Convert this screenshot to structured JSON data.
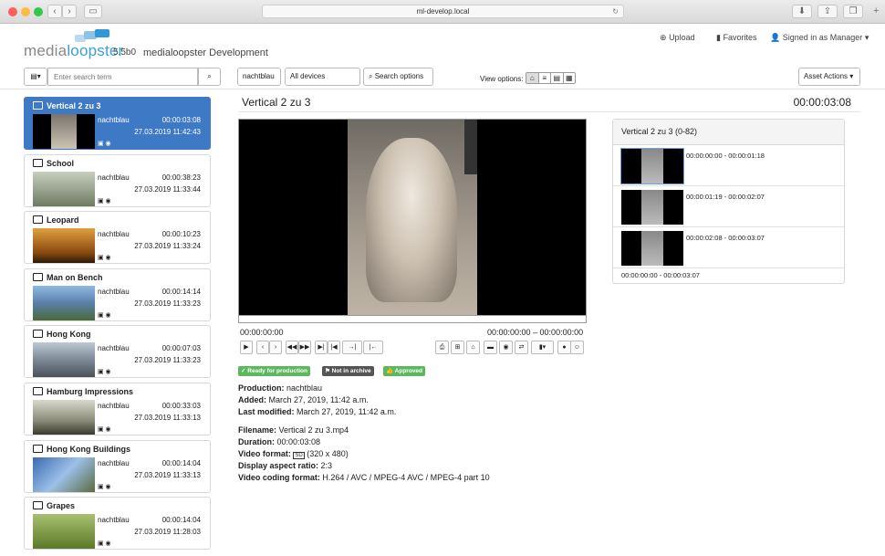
{
  "browser": {
    "url": "ml-develop.local",
    "back": "‹",
    "fwd": "›"
  },
  "app": {
    "logo_a": "media",
    "logo_b": "loopster",
    "version": "5.5b0",
    "name": "medialoopster Development"
  },
  "nav": {
    "upload": "Upload",
    "favorites": "Favorites",
    "signed_in": "Signed in as Manager"
  },
  "search": {
    "placeholder": "Enter search term"
  },
  "filters": {
    "production": "nachtblau",
    "devices": "All devices",
    "options": "Search options"
  },
  "view_options_label": "View options:",
  "asset_actions": "Asset Actions",
  "assets": [
    {
      "title": "Vertical 2 zu 3",
      "production": "nachtblau",
      "duration": "00:00:03:08",
      "date": "27.03.2019 11:42:43"
    },
    {
      "title": "School",
      "production": "nachtblau",
      "duration": "00:00:38:23",
      "date": "27.03.2019 11:33:44"
    },
    {
      "title": "Leopard",
      "production": "nachtblau",
      "duration": "00:00:10:23",
      "date": "27.03.2019 11:33:24"
    },
    {
      "title": "Man on Bench",
      "production": "nachtblau",
      "duration": "00:00:14:14",
      "date": "27.03.2019 11:33:23"
    },
    {
      "title": "Hong Kong",
      "production": "nachtblau",
      "duration": "00:00:07:03",
      "date": "27.03.2019 11:33:23"
    },
    {
      "title": "Hamburg Impressions",
      "production": "nachtblau",
      "duration": "00:00:33:03",
      "date": "27.03.2019 11:33:13"
    },
    {
      "title": "Hong Kong Buildings",
      "production": "nachtblau",
      "duration": "00:00:14:04",
      "date": "27.03.2019 11:33:13"
    },
    {
      "title": "Grapes",
      "production": "nachtblau",
      "duration": "00:00:14:04",
      "date": "27.03.2019 11:28:03"
    }
  ],
  "detail": {
    "title": "Vertical 2 zu 3",
    "duration": "00:00:03:08",
    "time_current": "00:00:00:00",
    "time_range": "00:00:00:00 – 00:00:00:00",
    "tags": {
      "ready": "Ready for production",
      "archive": "Not in archive",
      "approved": "Approved"
    },
    "production_label": "Production:",
    "production": "nachtblau",
    "added_label": "Added:",
    "added": "March 27, 2019, 11:42 a.m.",
    "modified_label": "Last modified:",
    "modified": "March 27, 2019, 11:42 a.m.",
    "filename_label": "Filename:",
    "filename": "Vertical 2 zu 3.mp4",
    "duration_label": "Duration:",
    "duration_val": "00:00:03:08",
    "format_label": "Video format:",
    "format_badge": "SD",
    "format": "(320 x 480)",
    "aspect_label": "Display aspect ratio:",
    "aspect": "2:3",
    "coding_label": "Video coding format:",
    "coding": "H.264 / AVC / MPEG-4 AVC / MPEG-4 part 10"
  },
  "segments": {
    "header": "Vertical 2 zu 3 (0-82)",
    "items": [
      "00:00:00:00 - 00:00:01:18",
      "00:00:01:19 - 00:00:02:07",
      "00:00:02:08 - 00:00:03:07"
    ],
    "footer": "00:00:00:00 - 00:00:03:07"
  },
  "colors": {
    "selected": "#3d79c4",
    "ready": "#5cb85c",
    "archive": "#555555"
  }
}
